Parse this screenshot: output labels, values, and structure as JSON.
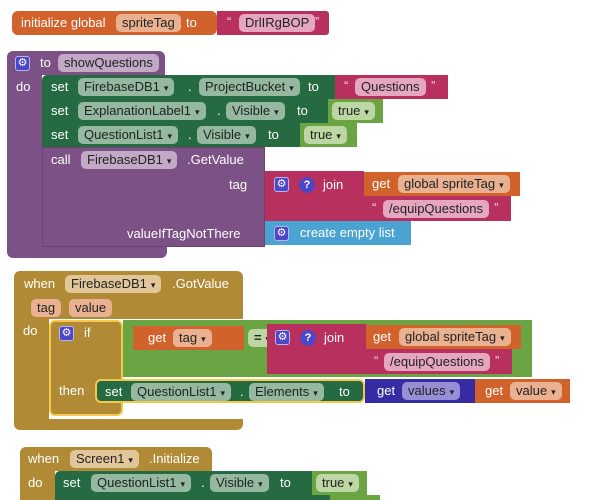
{
  "global_init": {
    "keyword": "initialize global",
    "var_name": "spriteTag",
    "to": "to",
    "value": "DrlIRgBOP"
  },
  "procedure": {
    "to": "to",
    "name": "showQuestions",
    "do": "do",
    "statements": [
      {
        "set": "set",
        "component": "FirebaseDB1",
        "property": "ProjectBucket",
        "to": "to",
        "value": "Questions"
      },
      {
        "set": "set",
        "component": "ExplanationLabel1",
        "property": "Visible",
        "to": "to",
        "value": "true"
      },
      {
        "set": "set",
        "component": "QuestionList1",
        "property": "Visible",
        "to": "to",
        "value": "true"
      }
    ],
    "call": {
      "keyword": "call",
      "component": "FirebaseDB1",
      "method": ".GetValue",
      "tag_label": "tag",
      "join": "join",
      "get": "get",
      "get_var": "global spriteTag",
      "text": "/equipQuestions",
      "value_label": "valueIfTagNotThere",
      "empty_list": "create empty list"
    }
  },
  "got_value_event": {
    "when": "when",
    "component": "FirebaseDB1",
    "event": ".GotValue",
    "params": [
      "tag",
      "value"
    ],
    "do": "do",
    "if": "if",
    "then": "then",
    "get": "get",
    "tag_var": "tag",
    "op": "=",
    "join": "join",
    "get_var": "global spriteTag",
    "text": "/equipQuestions",
    "set": "set",
    "set_component": "QuestionList1",
    "set_property": "Elements",
    "to": "to",
    "values_block": "values",
    "value_var": "value"
  },
  "screen_init_event": {
    "when": "when",
    "component": "Screen1",
    "event": ".Initialize",
    "do": "do",
    "set": "set",
    "set_component": "QuestionList1",
    "set_property": "Visible",
    "to": "to",
    "value": "true"
  },
  "icons": {
    "gear": "⚙",
    "help": "?",
    "dropdown": "▾"
  }
}
